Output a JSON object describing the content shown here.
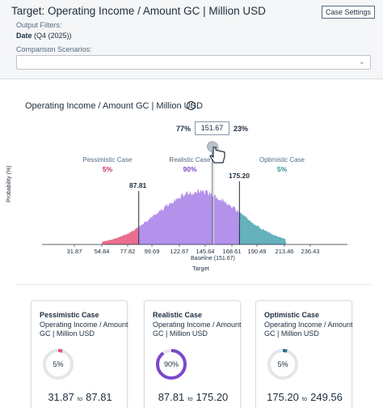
{
  "header": {
    "title": "Target: Operating Income / Amount GC | Million USD",
    "case_settings_label": "Case Settings",
    "output_filters_label": "Output Filters:",
    "filter_name": "Date",
    "filter_value": "(Q4 (2025))",
    "comparison_label": "Comparison Scenarios:",
    "comparison_value": ""
  },
  "chart": {
    "title": "Operating Income / Amount GC | Million USD",
    "left_pct": "77%",
    "baseline_input": "151.67",
    "right_pct": "23%",
    "ylabel": "Probability (%)",
    "xlabel": "Target",
    "baseline_label": "Baseline (151.67)",
    "pessimistic_label": "Pessimistic Case",
    "pessimistic_pct": "5%",
    "realistic_label": "Realistic Case",
    "realistic_pct": "90%",
    "optimistic_label": "Optimistic Case",
    "optimistic_pct": "5%",
    "low_marker": "87.81",
    "high_marker": "175.20",
    "ticks": [
      "31.87",
      "54.84",
      "77.82",
      "99.69",
      "122.67",
      "145.64",
      "168.61",
      "190.49",
      "213.46",
      "236.43"
    ],
    "colors": {
      "pessimistic": "#e8557a",
      "realistic": "#a77ee6",
      "optimistic": "#4aa3b0"
    }
  },
  "chart_data": {
    "type": "area",
    "title": "Operating Income / Amount GC | Million USD",
    "xlabel": "Target",
    "ylabel": "Probability (%)",
    "x_ticks": [
      31.87,
      54.84,
      77.82,
      99.69,
      122.67,
      145.64,
      168.61,
      190.49,
      213.46,
      236.43
    ],
    "baseline": 151.67,
    "bands": [
      {
        "name": "Pessimistic Case",
        "from": 31.87,
        "to": 87.81,
        "probability": 5
      },
      {
        "name": "Realistic Case",
        "from": 87.81,
        "to": 175.2,
        "probability": 90
      },
      {
        "name": "Optimistic Case",
        "from": 175.2,
        "to": 249.56,
        "probability": 5
      }
    ],
    "below_baseline_pct": 77,
    "above_baseline_pct": 23
  },
  "cards": [
    {
      "title": "Pessimistic Case",
      "subtitle": "Operating Income / Amount GC | Million USD",
      "pct": "5%",
      "pct_value": 5,
      "from": "31.87",
      "to": "87.81",
      "to_label": "to",
      "color": "#e8557a"
    },
    {
      "title": "Realistic Case",
      "subtitle": "Operating Income / Amount GC | Million USD",
      "pct": "90%",
      "pct_value": 90,
      "from": "87.81",
      "to": "175.20",
      "to_label": "to",
      "color": "#7a49cc"
    },
    {
      "title": "Optimistic Case",
      "subtitle": "Operating Income / Amount GC | Million USD",
      "pct": "5%",
      "pct_value": 5,
      "from": "175.20",
      "to": "249.56",
      "to_label": "to",
      "color": "#2f6f8f"
    }
  ]
}
